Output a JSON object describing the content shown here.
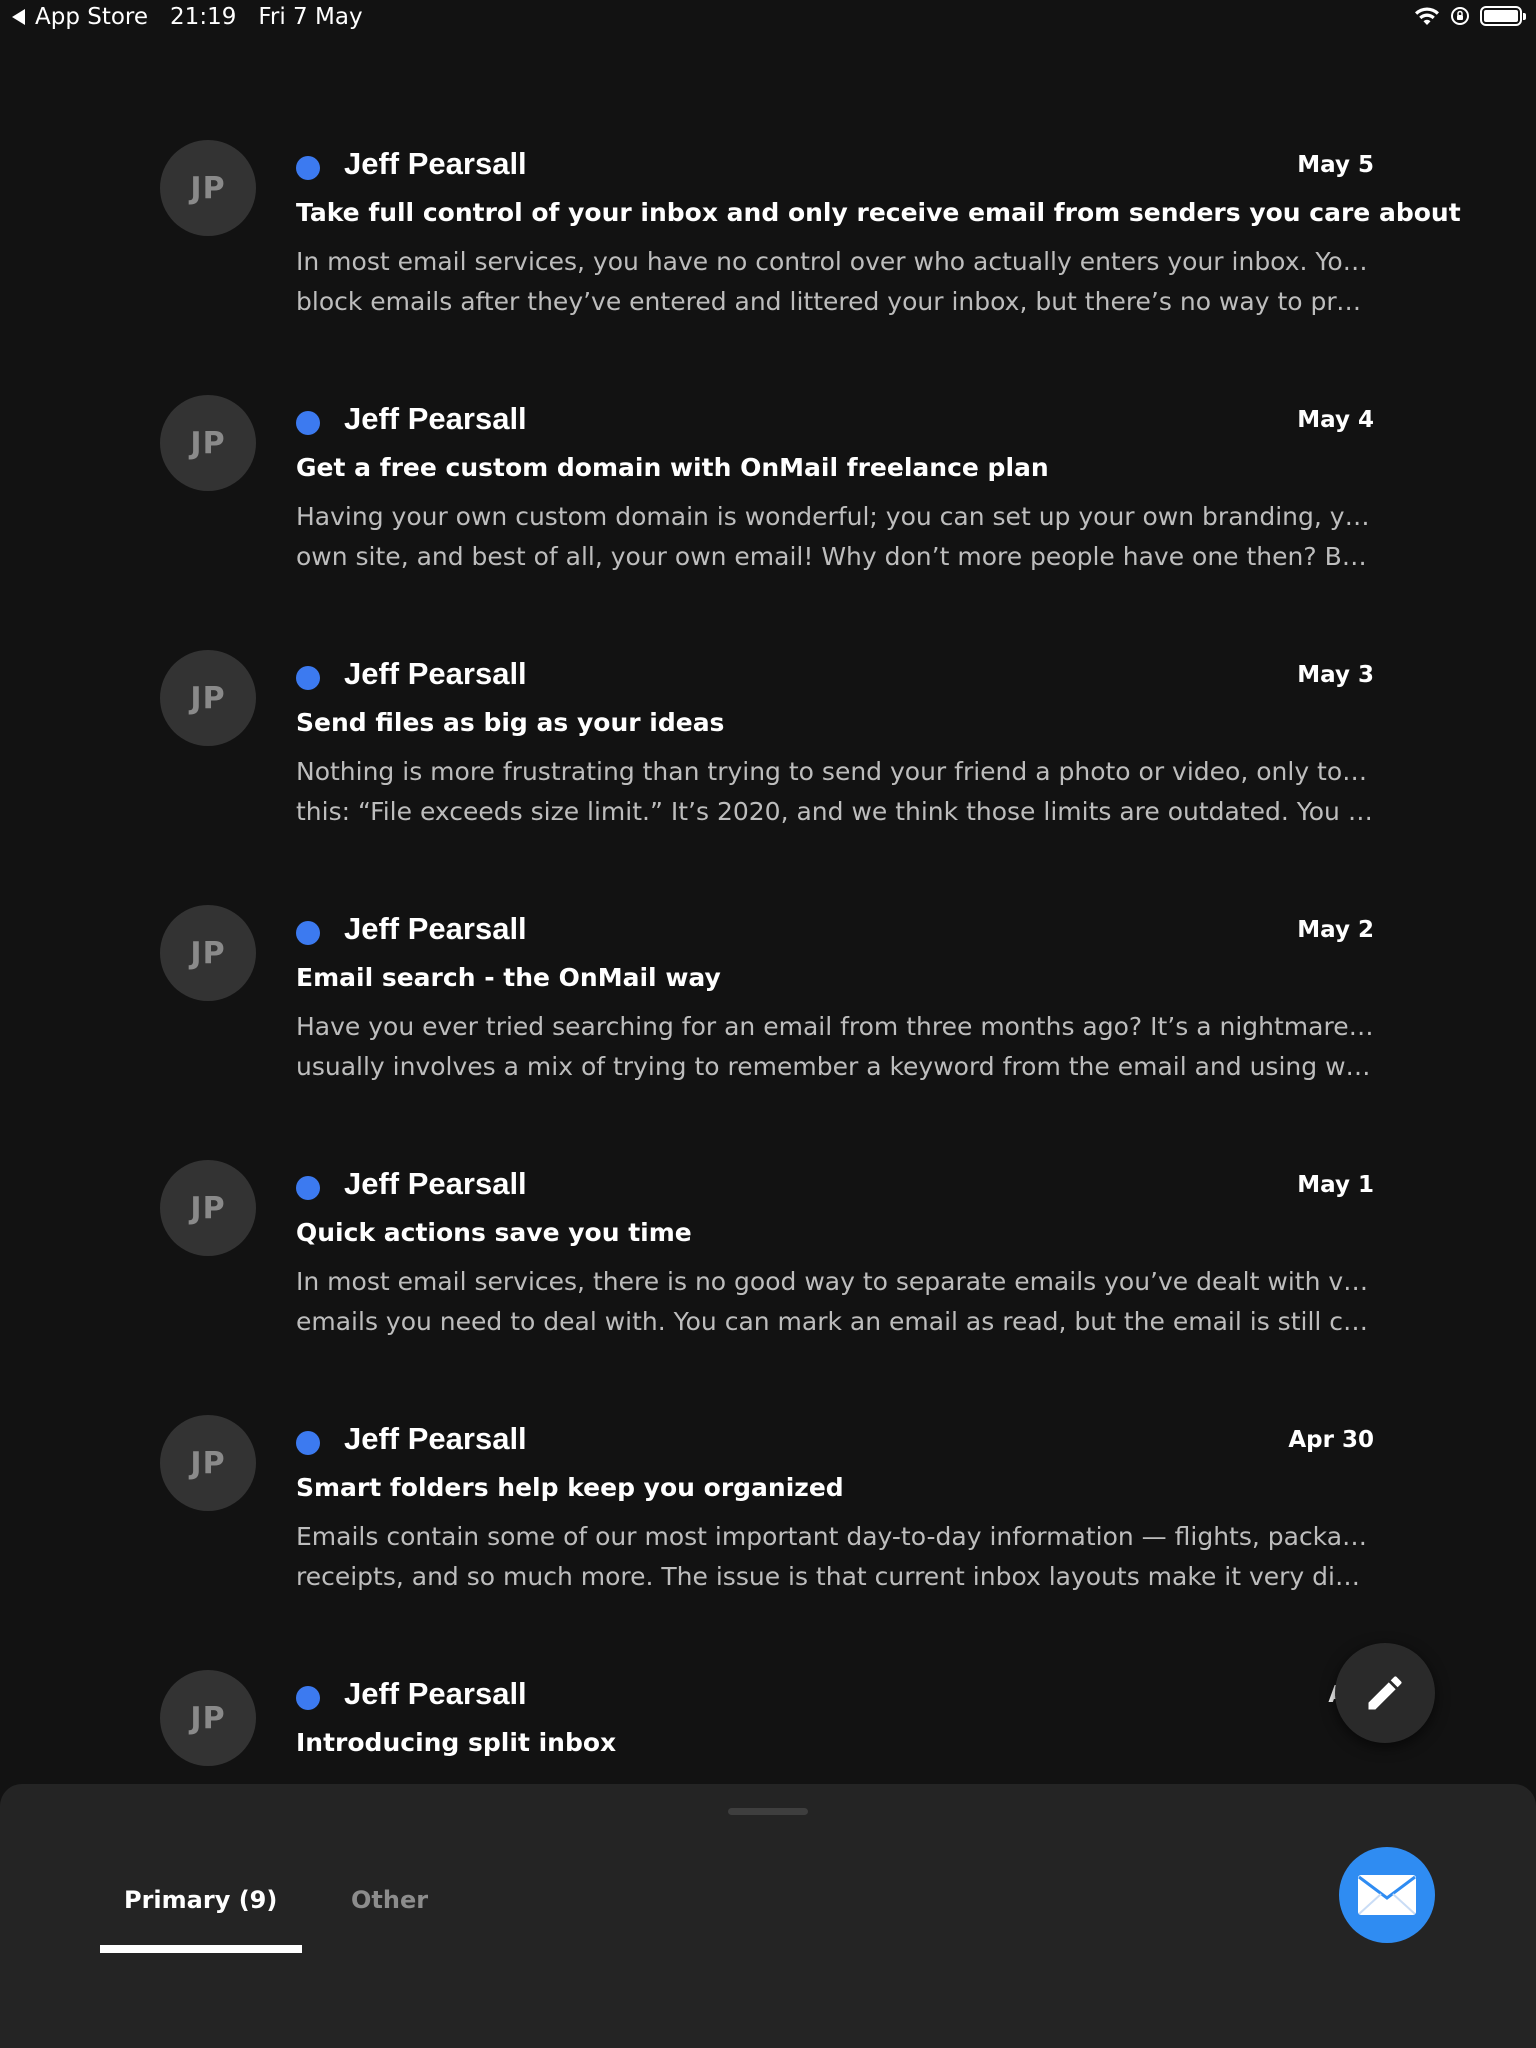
{
  "status_bar": {
    "back_label": "App Store",
    "time": "21:19",
    "date": "Fri 7 May",
    "battery_level": 1.0
  },
  "emails": [
    {
      "avatar_initials": "JP",
      "sender": "Jeff Pearsall",
      "date": "May 5",
      "subject": "Take full control of your inbox and only receive email from senders you care about",
      "preview_line1": "In most email services, you have no control over who actually enters your inbox. You can",
      "preview_line2": "block emails after they’ve entered and littered your inbox, but there’s no way to proacti...",
      "unread": true
    },
    {
      "avatar_initials": "JP",
      "sender": "Jeff Pearsall",
      "date": "May 4",
      "subject": "Get a free custom domain with OnMail freelance plan",
      "preview_line1": "Having your own custom domain is wonderful; you can set up your own branding, your",
      "preview_line2": "own site, and best of all, your own email! Why don’t more people have one then? Becau...",
      "unread": true
    },
    {
      "avatar_initials": "JP",
      "sender": "Jeff Pearsall",
      "date": "May 3",
      "subject": "Send files as big as your ideas",
      "preview_line1": "Nothing is more frustrating than trying to send your friend a photo or video, only to see",
      "preview_line2": "this: “File exceeds size limit.” It’s 2020, and we think those limits are outdated. You can...",
      "unread": true
    },
    {
      "avatar_initials": "JP",
      "sender": "Jeff Pearsall",
      "date": "May 2",
      "subject": "Email search - the OnMail way",
      "preview_line1": "Have you ever tried searching for an email from three months ago? It’s a nightmare, and",
      "preview_line2": "usually involves a mix of trying to remember a keyword from the email and using weird...",
      "unread": true
    },
    {
      "avatar_initials": "JP",
      "sender": "Jeff Pearsall",
      "date": "May 1",
      "subject": "Quick actions save you time",
      "preview_line1": "In most email services, there is no good way to separate emails you’ve dealt with versus",
      "preview_line2": "emails you need to deal with. You can mark an email as read, but the email is still clutter...",
      "unread": true
    },
    {
      "avatar_initials": "JP",
      "sender": "Jeff Pearsall",
      "date": "Apr 30",
      "subject": "Smart folders help keep you organized",
      "preview_line1": "Emails contain some of our most important day-to-day information — flights, packages,",
      "preview_line2": "receipts, and so much more. The issue is that current inbox layouts make it very difficul...",
      "unread": true
    },
    {
      "avatar_initials": "JP",
      "sender": "Jeff Pearsall",
      "date": "Apr",
      "subject": "Introducing split inbox",
      "preview_line1": "",
      "preview_line2": "",
      "unread": true
    }
  ],
  "tabs": {
    "primary": "Primary (9)",
    "other": "Other"
  },
  "colors": {
    "background": "#121212",
    "sheet": "#242424",
    "unread_dot": "#3c7af0",
    "mail_fab": "#2f8cf2"
  },
  "icons": {
    "compose": "pencil-icon",
    "mail": "envelope-icon",
    "wifi": "wifi-icon",
    "rotation_lock": "rotation-lock-icon",
    "battery": "battery-icon",
    "back": "back-arrow-icon"
  }
}
